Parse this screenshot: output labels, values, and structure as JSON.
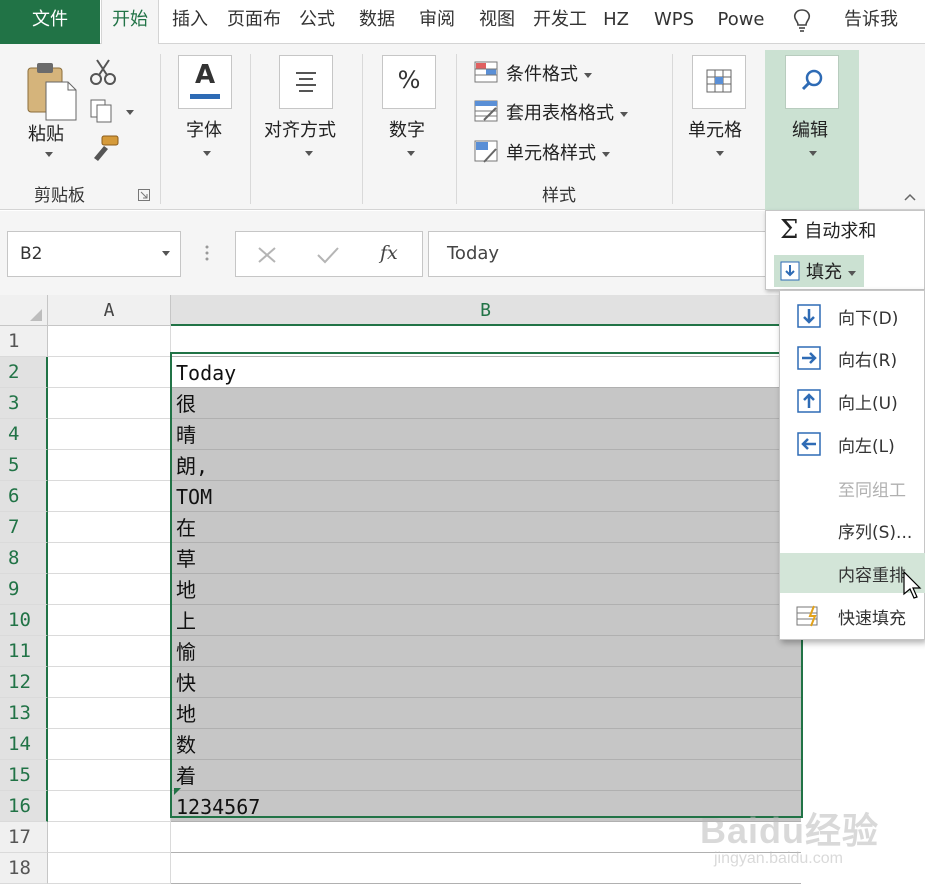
{
  "tabs": [
    "文件",
    "开始",
    "插入",
    "页面布",
    "公式",
    "数据",
    "审阅",
    "视图",
    "开发工",
    "HZ",
    "WPS",
    "Powe",
    "告诉我"
  ],
  "ribbon": {
    "paste": "粘贴",
    "clipboard_group": "剪贴板",
    "font": "字体",
    "font_glyph": "A",
    "align": "对齐方式",
    "number": "数字",
    "number_glyph": "%",
    "cond_format": "条件格式",
    "table_format": "套用表格格式",
    "cell_style": "单元格样式",
    "styles_group": "样式",
    "cells": "单元格",
    "edit": "编辑"
  },
  "formula_bar": {
    "name_box": "B2",
    "fx": "fx",
    "value": "Today"
  },
  "grid": {
    "col_a": "A",
    "col_b": "B",
    "rows": [
      {
        "num": "1",
        "b": ""
      },
      {
        "num": "2",
        "b": "Today"
      },
      {
        "num": "3",
        "b": "很"
      },
      {
        "num": "4",
        "b": "晴"
      },
      {
        "num": "5",
        "b": "朗,"
      },
      {
        "num": "6",
        "b": "TOM"
      },
      {
        "num": "7",
        "b": "在"
      },
      {
        "num": "8",
        "b": "草"
      },
      {
        "num": "9",
        "b": "地"
      },
      {
        "num": "10",
        "b": "上"
      },
      {
        "num": "11",
        "b": "愉"
      },
      {
        "num": "12",
        "b": "快"
      },
      {
        "num": "13",
        "b": "地"
      },
      {
        "num": "14",
        "b": "数"
      },
      {
        "num": "15",
        "b": "着"
      },
      {
        "num": "16",
        "b": "1234567"
      },
      {
        "num": "17",
        "b": ""
      },
      {
        "num": "18",
        "b": ""
      }
    ]
  },
  "edit_menu": {
    "autosum": "自动求和",
    "fill": "填充"
  },
  "fill_menu": {
    "down": "向下(D)",
    "right": "向右(R)",
    "up": "向上(U)",
    "left": "向左(L)",
    "across": "至同组工",
    "series": "序列(S)...",
    "justify": "内容重排",
    "flash": "快速填充"
  },
  "watermark": {
    "brand": "Baidu经验",
    "url": "jingyan.baidu.com"
  },
  "colors": {
    "accent": "#217346",
    "selection_shade": "#c6c6c6",
    "menu_highlight": "#d3e5d8"
  }
}
